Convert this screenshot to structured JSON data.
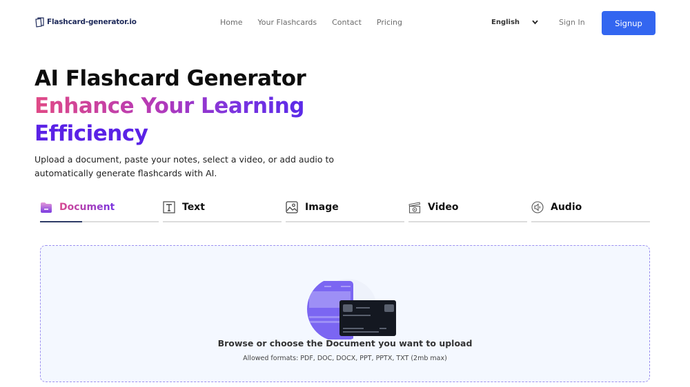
{
  "header": {
    "logo_text": "Flashcard-generator.io",
    "nav": [
      "Home",
      "Your Flashcards",
      "Contact",
      "Pricing"
    ],
    "language": "English",
    "signin_label": "Sign In",
    "signup_label": "Signup",
    "accent_color": "#3366f0"
  },
  "hero": {
    "title": "AI Flashcard Generator",
    "subtitle_line1": "Enhance Your Learning",
    "subtitle_line2": "Efficiency",
    "description": "Upload a document, paste your notes, select a video, or add audio to automatically generate flashcards with AI."
  },
  "tabs": [
    {
      "label": "Document",
      "icon": "folder-icon",
      "active": true
    },
    {
      "label": "Text",
      "icon": "text-icon",
      "active": false
    },
    {
      "label": "Image",
      "icon": "image-icon",
      "active": false
    },
    {
      "label": "Video",
      "icon": "clapperboard-icon",
      "active": false
    },
    {
      "label": "Audio",
      "icon": "speaker-icon",
      "active": false
    }
  ],
  "upload": {
    "title": "Browse or choose the Document you want to upload",
    "formats": "Allowed formats: PDF, DOC, DOCX, PPT, PPTX, TXT (2mb max)"
  }
}
